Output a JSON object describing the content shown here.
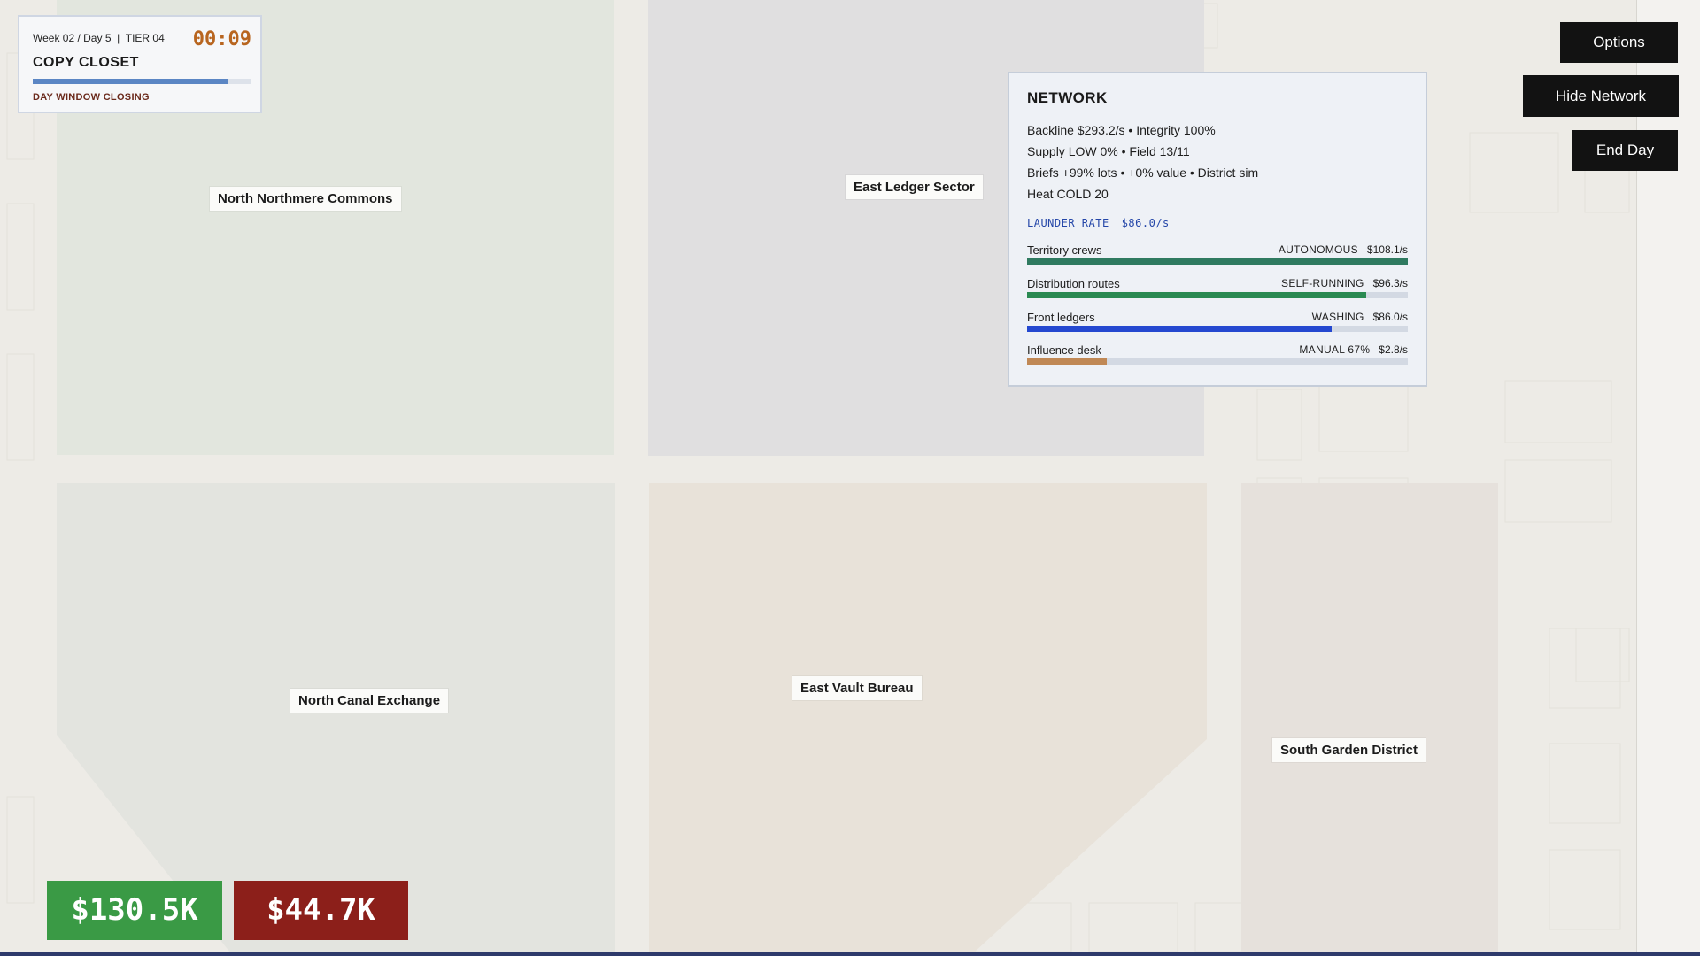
{
  "hud": {
    "week_day": "Week 02 / Day 5",
    "tier": "TIER 04",
    "timer": "00:09",
    "location": "COPY CLOSET",
    "day_progress": 0.9,
    "warning": "DAY WINDOW CLOSING"
  },
  "buttons": {
    "options": "Options",
    "hide_network": "Hide Network",
    "end_day": "End Day"
  },
  "districts": {
    "north_northmere": "North Northmere Commons",
    "east_ledger": "East Ledger Sector",
    "north_canal": "North Canal Exchange",
    "east_vault": "East Vault Bureau",
    "south_garden": "South Garden District"
  },
  "network": {
    "title": "NETWORK",
    "lines": [
      "Backline  $293.2/s  •  Integrity  100%",
      "Supply LOW 0%  •  Field 13/11",
      "Briefs +99% lots  •  +0% value  •  District sim",
      "Heat  COLD 20"
    ],
    "launder_label": "LAUNDER RATE",
    "launder_value": "$86.0/s",
    "rows": [
      {
        "label": "Territory crews",
        "mode": "AUTONOMOUS",
        "rate": "$108.1/s",
        "fill": 1.0,
        "color": "#2f7a60"
      },
      {
        "label": "Distribution routes",
        "mode": "SELF-RUNNING",
        "rate": "$96.3/s",
        "fill": 0.89,
        "color": "#2a8a52"
      },
      {
        "label": "Front ledgers",
        "mode": "WASHING",
        "rate": "$86.0/s",
        "fill": 0.8,
        "color": "#2448d0"
      },
      {
        "label": "Influence desk",
        "mode": "MANUAL 67%",
        "rate": "$2.8/s",
        "fill": 0.21,
        "color": "#c08855"
      }
    ]
  },
  "money": {
    "clean": "$130.5K",
    "dirty": "$44.7K"
  },
  "colors": {
    "clean": "#3a9a45",
    "dirty": "#8c1f1a",
    "timer": "#b8651f"
  }
}
